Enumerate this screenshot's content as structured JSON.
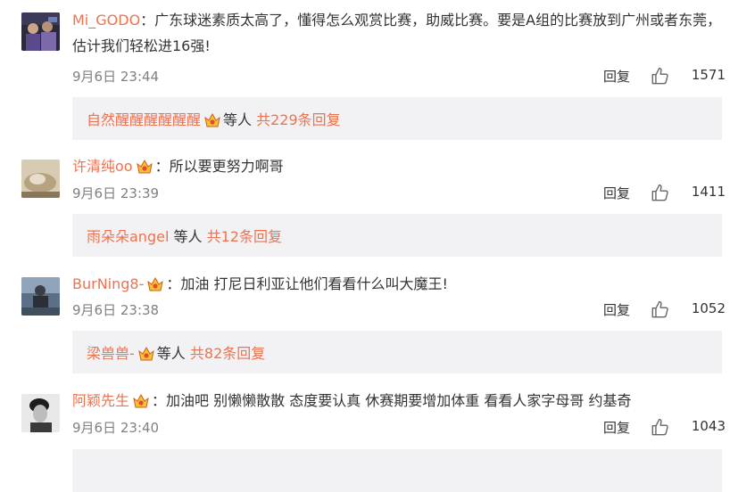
{
  "comments": [
    {
      "username": "Mi_GODO",
      "separator": "：",
      "text": "广东球迷素质太高了，懂得怎么观赏比赛，助威比赛。要是A组的比赛放到广州或者东莞，估计我们轻松进16强!",
      "time": "9月6日 23:44",
      "reply_label": "回复",
      "likes": "1571",
      "sub": {
        "user": "自然醒醒醒醒醒醒",
        "middle": "等人",
        "link": "共229条回复"
      }
    },
    {
      "username": "许清纯oo",
      "separator": "：",
      "text": "所以要更努力啊哥",
      "time": "9月6日 23:39",
      "reply_label": "回复",
      "likes": "1411",
      "sub": {
        "user": "雨朵朵angel",
        "middle": "等人",
        "link": "共12条回复"
      }
    },
    {
      "username": "BurNing8-",
      "separator": "：",
      "text": "加油 打尼日利亚让他们看看什么叫大魔王!",
      "time": "9月6日 23:38",
      "reply_label": "回复",
      "likes": "1052",
      "sub": {
        "user": "梁兽兽-",
        "middle": "等人",
        "link": "共82条回复"
      }
    },
    {
      "username": "阿颖先生",
      "separator": "：",
      "text": "加油吧 别懒懒散散 态度要认真 休赛期要增加体重 看看人家字母哥 约基奇",
      "time": "9月6日 23:40",
      "reply_label": "回复",
      "likes": "1043"
    }
  ],
  "colors": {
    "username": "#eb7350",
    "meta": "#808080",
    "sub_bg": "#f2f2f5"
  },
  "icons": {
    "crown": "crown-badge-icon",
    "like": "thumbs-up-icon"
  }
}
